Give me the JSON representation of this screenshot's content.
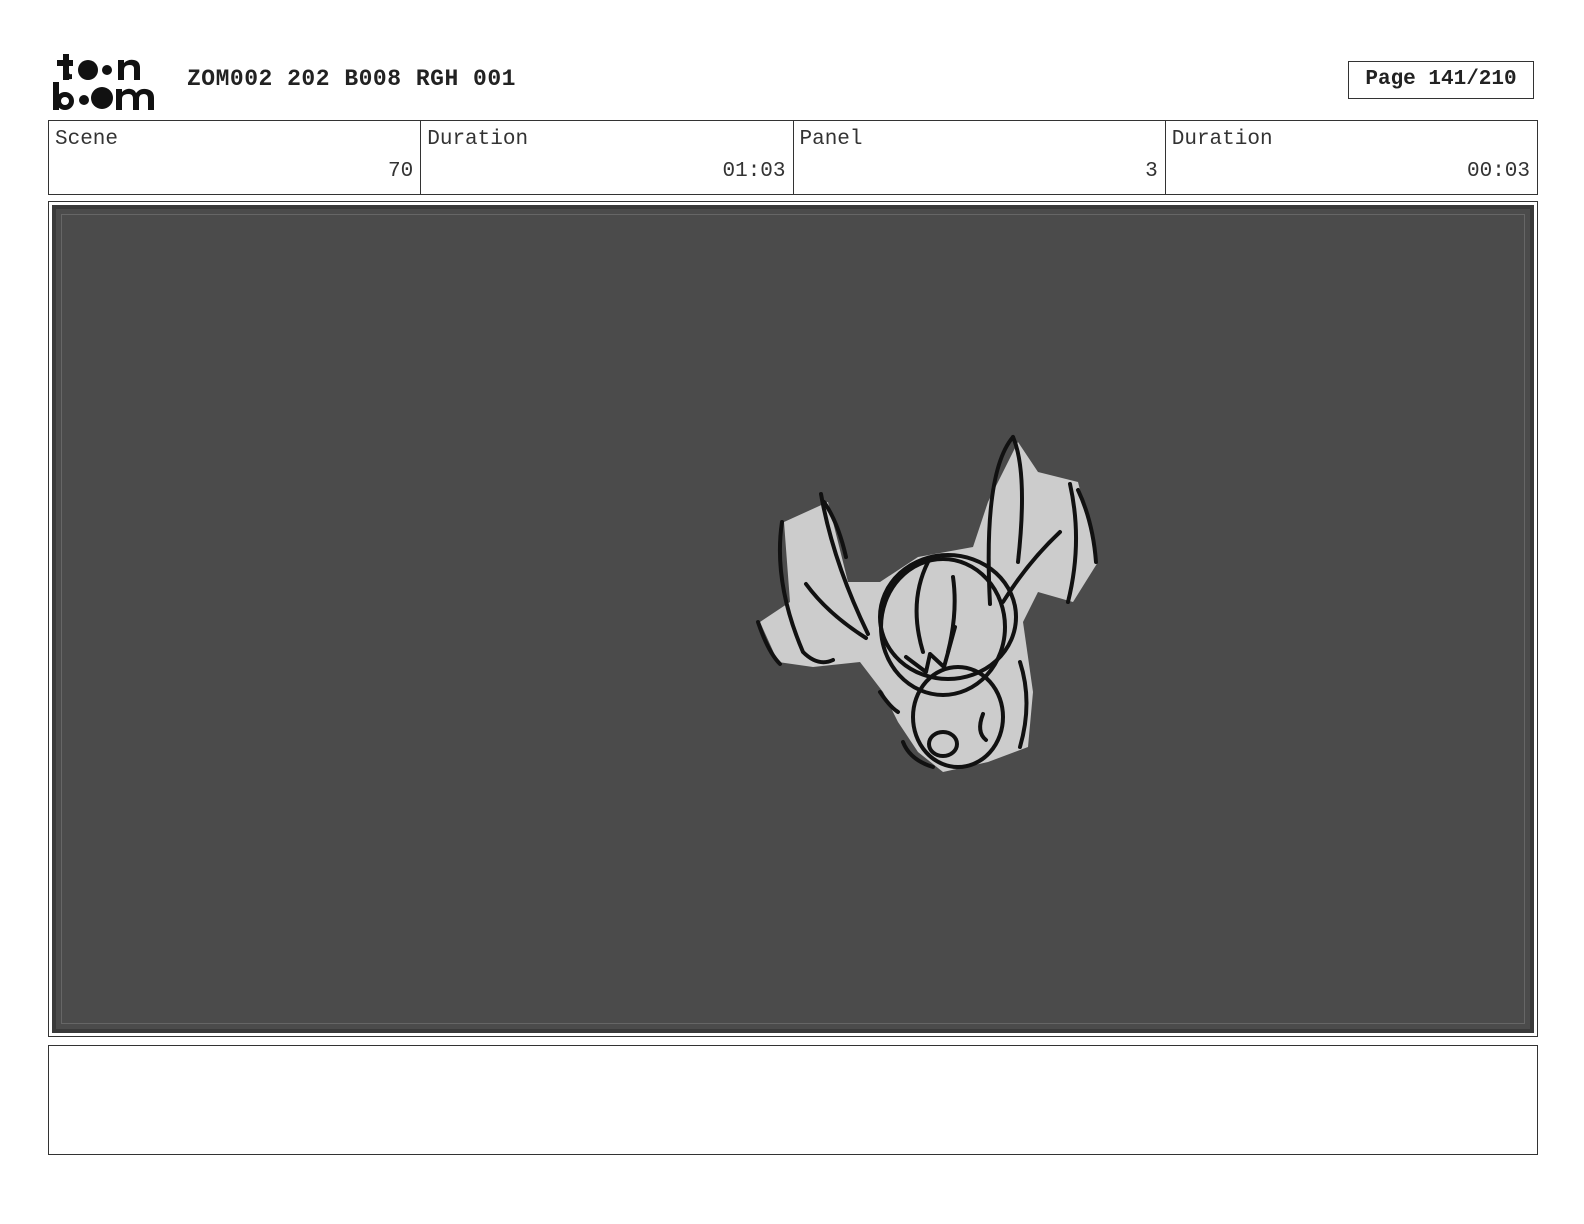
{
  "header": {
    "logo": {
      "icon": "toon-boom-logo-icon",
      "line1": "toon",
      "line2": "boom"
    },
    "doc_id": "ZOM002 202 B008 RGH 001",
    "page_label": "Page 141/210"
  },
  "info": {
    "scene_label": "Scene",
    "scene_value": "70",
    "scene_duration_label": "Duration",
    "scene_duration_value": "01:03",
    "panel_label": "Panel",
    "panel_value": "3",
    "panel_duration_label": "Duration",
    "panel_duration_value": "00:03"
  },
  "panel": {
    "background_color": "#4b4b4b",
    "sketch_fill": "#cccccc",
    "sketch_icon": "bat-sketch-icon"
  },
  "notes": {
    "text": ""
  }
}
